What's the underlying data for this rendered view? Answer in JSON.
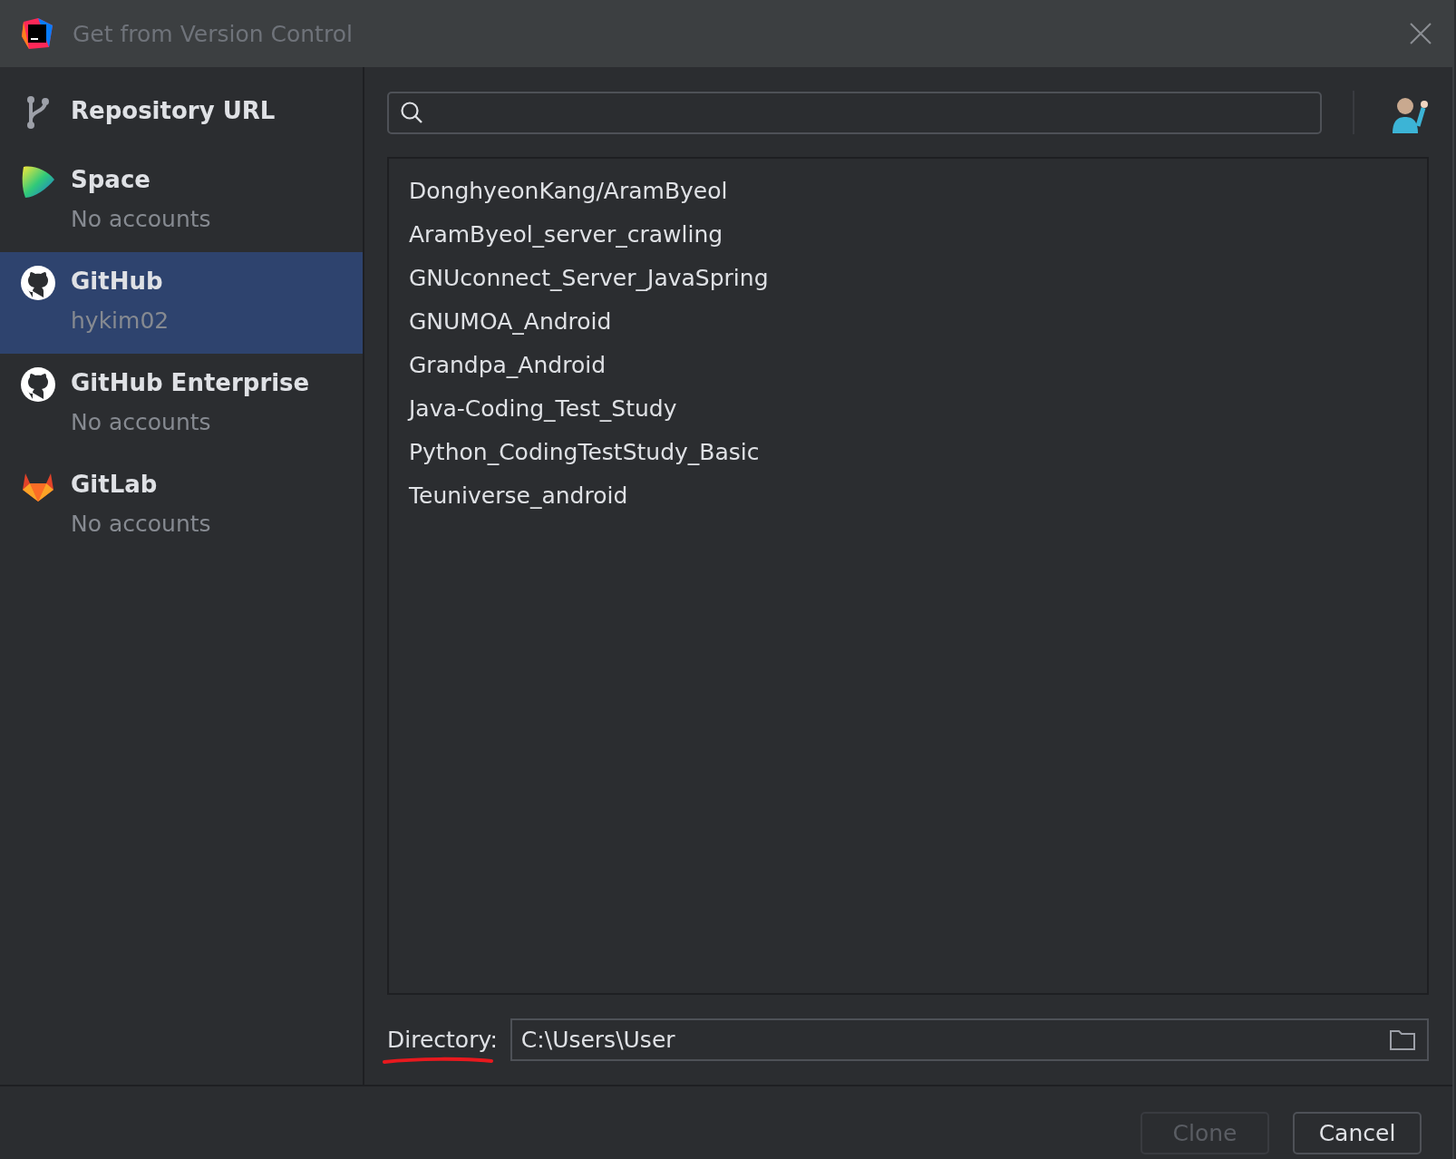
{
  "window": {
    "title": "Get from Version Control"
  },
  "sidebar": {
    "items": [
      {
        "kind": "url",
        "label": "Repository URL",
        "selected": false
      },
      {
        "kind": "space",
        "label": "Space",
        "account": "No accounts",
        "selected": false
      },
      {
        "kind": "github",
        "label": "GitHub",
        "account": "hykim02",
        "selected": true
      },
      {
        "kind": "github",
        "label": "GitHub Enterprise",
        "account": "No accounts",
        "selected": false
      },
      {
        "kind": "gitlab",
        "label": "GitLab",
        "account": "No accounts",
        "selected": false
      }
    ]
  },
  "repositories": [
    "DonghyeonKang/AramByeol",
    "AramByeol_server_crawling",
    "GNUconnect_Server_JavaSpring",
    "GNUMOA_Android",
    "Grandpa_Android",
    "Java-Coding_Test_Study",
    "Python_CodingTestStudy_Basic",
    "Teuniverse_android"
  ],
  "directory": {
    "label": "Directory:",
    "value": "C:\\Users\\User",
    "underlined": true
  },
  "buttons": [
    {
      "label": "Clone",
      "disabled": true
    },
    {
      "label": "Cancel",
      "disabled": false
    }
  ]
}
